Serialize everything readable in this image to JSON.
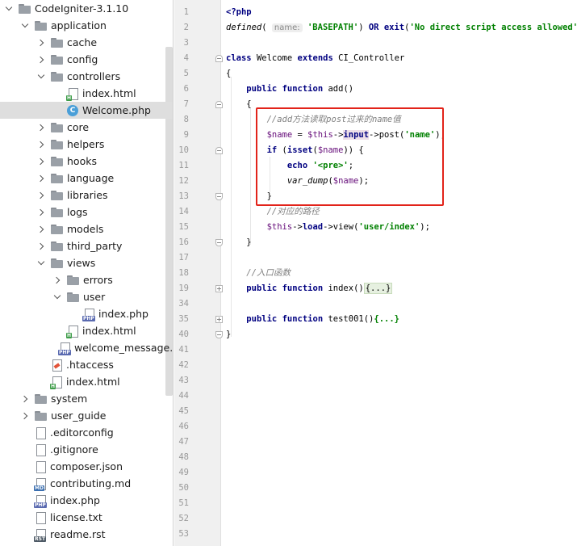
{
  "project": {
    "items": [
      {
        "label": "CodeIgniter-3.1.10",
        "type": "folder",
        "depth": 0,
        "arrow": "down"
      },
      {
        "label": "application",
        "type": "folder",
        "depth": 1,
        "arrow": "down"
      },
      {
        "label": "cache",
        "type": "folder",
        "depth": 2,
        "arrow": "right"
      },
      {
        "label": "config",
        "type": "folder",
        "depth": 2,
        "arrow": "right"
      },
      {
        "label": "controllers",
        "type": "folder",
        "depth": 2,
        "arrow": "down"
      },
      {
        "label": "index.html",
        "type": "html",
        "depth": 3,
        "arrow": "none"
      },
      {
        "label": "Welcome.php",
        "type": "class",
        "depth": 3,
        "arrow": "none",
        "selected": true
      },
      {
        "label": "core",
        "type": "folder",
        "depth": 2,
        "arrow": "right"
      },
      {
        "label": "helpers",
        "type": "folder",
        "depth": 2,
        "arrow": "right"
      },
      {
        "label": "hooks",
        "type": "folder",
        "depth": 2,
        "arrow": "right"
      },
      {
        "label": "language",
        "type": "folder",
        "depth": 2,
        "arrow": "right"
      },
      {
        "label": "libraries",
        "type": "folder",
        "depth": 2,
        "arrow": "right"
      },
      {
        "label": "logs",
        "type": "folder",
        "depth": 2,
        "arrow": "right"
      },
      {
        "label": "models",
        "type": "folder",
        "depth": 2,
        "arrow": "right"
      },
      {
        "label": "third_party",
        "type": "folder",
        "depth": 2,
        "arrow": "right"
      },
      {
        "label": "views",
        "type": "folder",
        "depth": 2,
        "arrow": "down"
      },
      {
        "label": "errors",
        "type": "folder",
        "depth": 3,
        "arrow": "right"
      },
      {
        "label": "user",
        "type": "folder",
        "depth": 3,
        "arrow": "down"
      },
      {
        "label": "index.php",
        "type": "php",
        "depth": 4,
        "arrow": "none"
      },
      {
        "label": "index.html",
        "type": "html",
        "depth": 3,
        "arrow": "none"
      },
      {
        "label": "welcome_message.php",
        "type": "php",
        "depth": 3,
        "arrow": "none"
      },
      {
        "label": ".htaccess",
        "type": "htaccess",
        "depth": 2,
        "arrow": "none"
      },
      {
        "label": "index.html",
        "type": "html",
        "depth": 2,
        "arrow": "none"
      },
      {
        "label": "system",
        "type": "folder",
        "depth": 1,
        "arrow": "right"
      },
      {
        "label": "user_guide",
        "type": "folder",
        "depth": 1,
        "arrow": "right"
      },
      {
        "label": ".editorconfig",
        "type": "text",
        "depth": 1,
        "arrow": "none"
      },
      {
        "label": ".gitignore",
        "type": "text",
        "depth": 1,
        "arrow": "none"
      },
      {
        "label": "composer.json",
        "type": "json",
        "depth": 1,
        "arrow": "none"
      },
      {
        "label": "contributing.md",
        "type": "md",
        "depth": 1,
        "arrow": "none"
      },
      {
        "label": "index.php",
        "type": "php",
        "depth": 1,
        "arrow": "none"
      },
      {
        "label": "license.txt",
        "type": "text",
        "depth": 1,
        "arrow": "none"
      },
      {
        "label": "readme.rst",
        "type": "rst",
        "depth": 1,
        "arrow": "none"
      }
    ],
    "badges": {
      "html": "H",
      "php": "PHP",
      "md": "MD",
      "rst": "RST",
      "class": "C"
    }
  },
  "editor": {
    "line_numbers": [
      "1",
      "2",
      "3",
      "4",
      "5",
      "6",
      "7",
      "8",
      "9",
      "10",
      "11",
      "12",
      "13",
      "14",
      "15",
      "16",
      "17",
      "18",
      "19",
      "34",
      "35",
      "40",
      "41",
      "42",
      "43",
      "44",
      "45",
      "46",
      "47",
      "48",
      "49",
      "50",
      "51",
      "52",
      "53"
    ],
    "code": {
      "l1": "<?php",
      "l2_fn": "defined",
      "l2_hint": "name:",
      "l2_str": "'BASEPATH'",
      "l2_or": "OR",
      "l2_exit": "exit",
      "l2_msg": "'No direct script access allowed'",
      "l4_class": "class",
      "l4_name": "Welcome",
      "l4_extends": "extends",
      "l4_parent": "CI_Controller",
      "brace_open": "{",
      "brace_close": "}",
      "kw_public": "public",
      "kw_function": "function",
      "fn_add": "add",
      "paren_empty": "()",
      "l8_comment": "//add方法读取post过来的name值",
      "l9_var": "$name",
      "l9_eq": " = ",
      "l9_this": "$this",
      "arrow_op": "->",
      "l9_input": "input",
      "l9_post": "post",
      "l9_arg": "'name'",
      "l10_if": "if",
      "l10_isset": "isset",
      "l11_echo": "echo",
      "l11_str": "'<pre>'",
      "l12_fn": "var_dump",
      "l14_comment": "//对应的路径",
      "l15_load": "load",
      "l15_view": "view",
      "l15_arg": "'user/index'",
      "l18_comment": "//入口函数",
      "fn_index": "index",
      "fn_test": "test001",
      "folded": "{...}"
    }
  },
  "colors": {
    "highlight_box": "#e2231a",
    "selected_row": "#dedede"
  }
}
